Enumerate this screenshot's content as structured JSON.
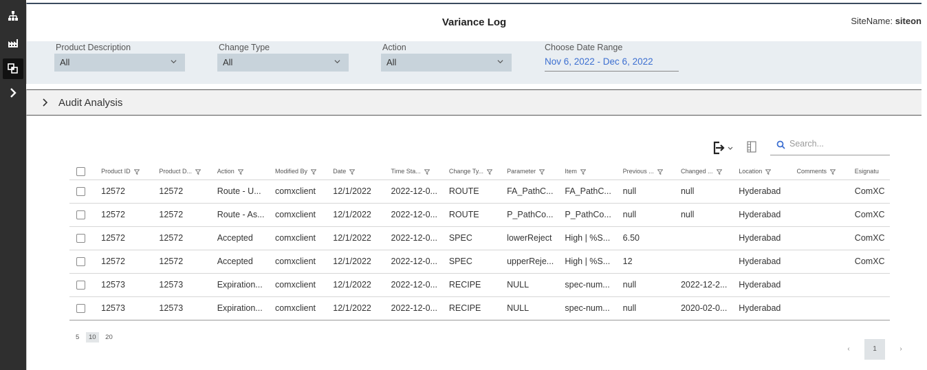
{
  "rail": {
    "items": [
      {
        "icon": "hierarchy-icon"
      },
      {
        "icon": "factory-icon"
      },
      {
        "icon": "layers-icon"
      },
      {
        "icon": "chevron-right-icon"
      }
    ]
  },
  "header": {
    "title": "Variance Log",
    "site_label": "SiteName:",
    "site_value": "siteon"
  },
  "filters": {
    "product_description": {
      "label": "Product Description",
      "value": "All"
    },
    "change_type": {
      "label": "Change Type",
      "value": "All"
    },
    "action": {
      "label": "Action",
      "value": "All"
    },
    "date_range": {
      "label": "Choose Date Range",
      "value": "Nov 6, 2022 - Dec 6, 2022"
    }
  },
  "audit": {
    "label": "Audit Analysis"
  },
  "toolbar": {
    "search_placeholder": "Search..."
  },
  "table": {
    "columns": [
      "Product ID",
      "Product D...",
      "Action",
      "Modified By",
      "Date",
      "Time Sta...",
      "Change Ty...",
      "Parameter",
      "Item",
      "Previous ...",
      "Changed ...",
      "Location",
      "Comments",
      "Esignatu"
    ],
    "rows": [
      [
        "12572",
        "12572",
        "Route - U...",
        "comxclient",
        "12/1/2022",
        "2022-12-0...",
        "ROUTE",
        "FA_PathC...",
        "FA_PathC...",
        "null",
        "null",
        "Hyderabad",
        "",
        "ComXC"
      ],
      [
        "12572",
        "12572",
        "Route - As...",
        "comxclient",
        "12/1/2022",
        "2022-12-0...",
        "ROUTE",
        "P_PathCo...",
        "P_PathCo...",
        "null",
        "null",
        "Hyderabad",
        "",
        "ComXC"
      ],
      [
        "12572",
        "12572",
        "Accepted",
        "comxclient",
        "12/1/2022",
        "2022-12-0...",
        "SPEC",
        "lowerReject",
        "High | %S...",
        "6.50",
        "",
        "Hyderabad",
        "",
        "ComXC"
      ],
      [
        "12572",
        "12572",
        "Accepted",
        "comxclient",
        "12/1/2022",
        "2022-12-0...",
        "SPEC",
        "upperReje...",
        "High | %S...",
        "12",
        "",
        "Hyderabad",
        "",
        "ComXC"
      ],
      [
        "12573",
        "12573",
        "Expiration...",
        "comxclient",
        "12/1/2022",
        "2022-12-0...",
        "RECIPE",
        "NULL",
        "spec-num...",
        "null",
        "2022-12-2...",
        "Hyderabad",
        "",
        ""
      ],
      [
        "12573",
        "12573",
        "Expiration...",
        "comxclient",
        "12/1/2022",
        "2022-12-0...",
        "RECIPE",
        "NULL",
        "spec-num...",
        "null",
        "2020-02-0...",
        "Hyderabad",
        "",
        ""
      ]
    ]
  },
  "pagination": {
    "page_sizes": [
      "5",
      "10",
      "20"
    ],
    "selected_size": "10",
    "prev": "‹",
    "current_page": "1",
    "next": "›"
  }
}
